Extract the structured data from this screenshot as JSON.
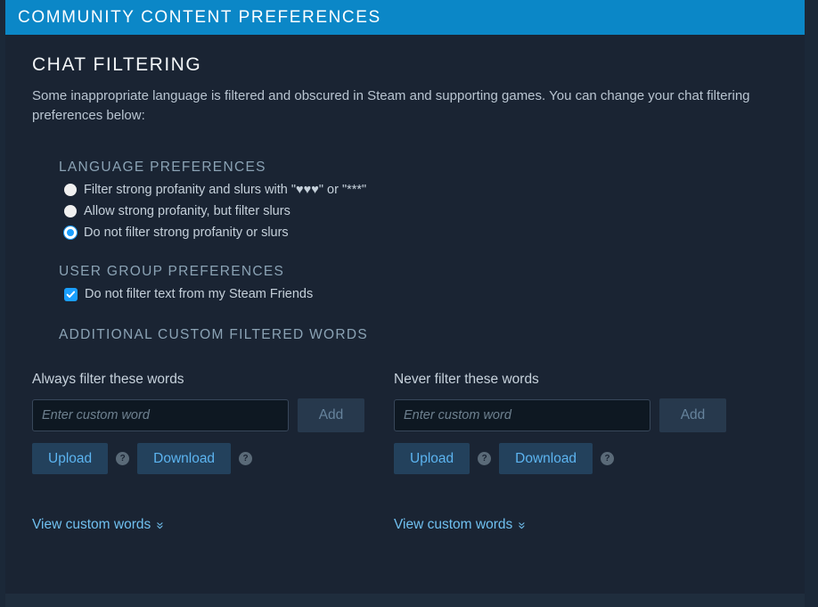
{
  "header": {
    "title": "COMMUNITY CONTENT PREFERENCES"
  },
  "main": {
    "section_title": "CHAT FILTERING",
    "intro": "Some inappropriate language is filtered and obscured in Steam and supporting games. You can change your chat filtering preferences below:"
  },
  "language_preferences": {
    "heading": "LANGUAGE PREFERENCES",
    "options": [
      {
        "label": "Filter strong profanity and slurs with \"♥♥♥\" or \"***\"",
        "selected": false
      },
      {
        "label": "Allow strong profanity, but filter slurs",
        "selected": false
      },
      {
        "label": "Do not filter strong profanity or slurs",
        "selected": true
      }
    ]
  },
  "user_group_preferences": {
    "heading": "USER GROUP PREFERENCES",
    "checkbox_label": "Do not filter text from my Steam Friends",
    "checked": true
  },
  "custom_filtered_words": {
    "heading": "ADDITIONAL CUSTOM FILTERED WORDS",
    "columns": [
      {
        "label": "Always filter these words",
        "input_placeholder": "Enter custom word",
        "input_value": "",
        "add_label": "Add",
        "upload_label": "Upload",
        "download_label": "Download",
        "help_icon": "?",
        "view_link": "View custom words"
      },
      {
        "label": "Never filter these words",
        "input_placeholder": "Enter custom word",
        "input_value": "",
        "add_label": "Add",
        "upload_label": "Upload",
        "download_label": "Download",
        "help_icon": "?",
        "view_link": "View custom words"
      }
    ]
  },
  "colors": {
    "header_bar": "#0b87c7",
    "page_background": "#1b2838",
    "panel_background": "#1a2433",
    "accent_blue": "#1a9fff",
    "link_blue": "#70c0f0"
  }
}
